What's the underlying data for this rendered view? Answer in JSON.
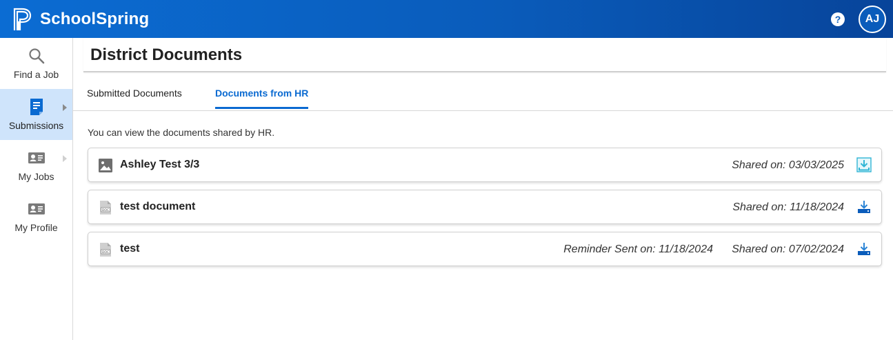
{
  "app": {
    "brand_name": "SchoolSpring",
    "user_initials": "AJ",
    "help_label": "?"
  },
  "colors": {
    "header_start": "#0b6cd3",
    "header_end": "#07449a",
    "accent": "#0a6ad1",
    "active_nav_bg": "#cfe4fb"
  },
  "sidebar": {
    "items": [
      {
        "label": "Find a Job",
        "icon": "search-icon"
      },
      {
        "label": "Submissions",
        "icon": "document-icon"
      },
      {
        "label": "My Jobs",
        "icon": "id-card-icon"
      },
      {
        "label": "My Profile",
        "icon": "id-card-icon"
      }
    ]
  },
  "page": {
    "title": "District Documents",
    "tabs": [
      {
        "label": "Submitted Documents"
      },
      {
        "label": "Documents from HR"
      }
    ],
    "intro": "You can view the documents shared by HR."
  },
  "documents": [
    {
      "name": "Ashley Test 3/3",
      "file_icon": "image-file-icon",
      "reminder": "",
      "shared": "Shared on: 03/03/2025"
    },
    {
      "name": "test document",
      "file_icon": "doc-file-icon",
      "reminder": "",
      "shared": "Shared on: 11/18/2024"
    },
    {
      "name": "test",
      "file_icon": "doc-file-icon",
      "reminder": "Reminder Sent on: 11/18/2024",
      "shared": "Shared on: 07/02/2024"
    }
  ]
}
